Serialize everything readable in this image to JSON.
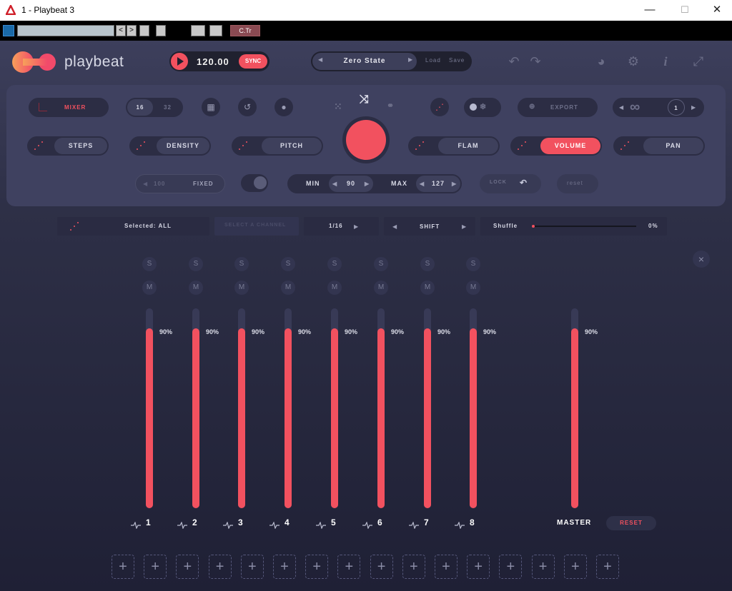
{
  "window": {
    "title": "1 - Playbeat 3",
    "min_glyph": "—",
    "max_glyph": "☐",
    "close_glyph": "✕"
  },
  "host": {
    "prev_glyph": "<",
    "next_glyph": ">",
    "ctr_label": "C.Tr"
  },
  "header": {
    "logo_text": "playbeat",
    "bpm": "120.00",
    "sync_label": "SYNC",
    "preset_name": "Zero State",
    "load_label": "Load",
    "save_label": "Save"
  },
  "panel": {
    "mixer_label": "MIXER",
    "steps16": "16",
    "steps32": "32",
    "export_label": "EXPORT",
    "loop_count": "1",
    "steps_label": "STEPS",
    "density_label": "DENSITY",
    "pitch_label": "PITCH",
    "flam_label": "FLAM",
    "volume_label": "VOLUME",
    "pan_label": "PAN",
    "fixed_value": "100",
    "fixed_label": "FIXED",
    "min_label": "MIN",
    "min_value": "90",
    "max_label": "MAX",
    "max_value": "127",
    "lock_label": "LOCK",
    "reset_label": "reset"
  },
  "controls": {
    "selected_label": "Selected: ALL",
    "select_channel": "SELECT A CHANNEL",
    "division": "1/16",
    "shift_label": "SHIFT",
    "shuffle_label": "Shuffle",
    "shuffle_value": "0%",
    "shuffle_level": 0
  },
  "mixer": {
    "solo_label": "S",
    "mute_label": "M",
    "channels": [
      {
        "name": "1",
        "level": 90,
        "label": "90%"
      },
      {
        "name": "2",
        "level": 90,
        "label": "90%"
      },
      {
        "name": "3",
        "level": 90,
        "label": "90%"
      },
      {
        "name": "4",
        "level": 90,
        "label": "90%"
      },
      {
        "name": "5",
        "level": 90,
        "label": "90%"
      },
      {
        "name": "6",
        "level": 90,
        "label": "90%"
      },
      {
        "name": "7",
        "level": 90,
        "label": "90%"
      },
      {
        "name": "8",
        "level": 90,
        "label": "90%"
      }
    ],
    "master": {
      "name": "MASTER",
      "level": 90,
      "label": "90%"
    },
    "reset_label": "RESET",
    "close_glyph": "×"
  },
  "add_slots": 16,
  "add_glyph": "+",
  "colors": {
    "accent": "#f2515f",
    "panel": "#3f4160",
    "background": "#2e3047"
  }
}
